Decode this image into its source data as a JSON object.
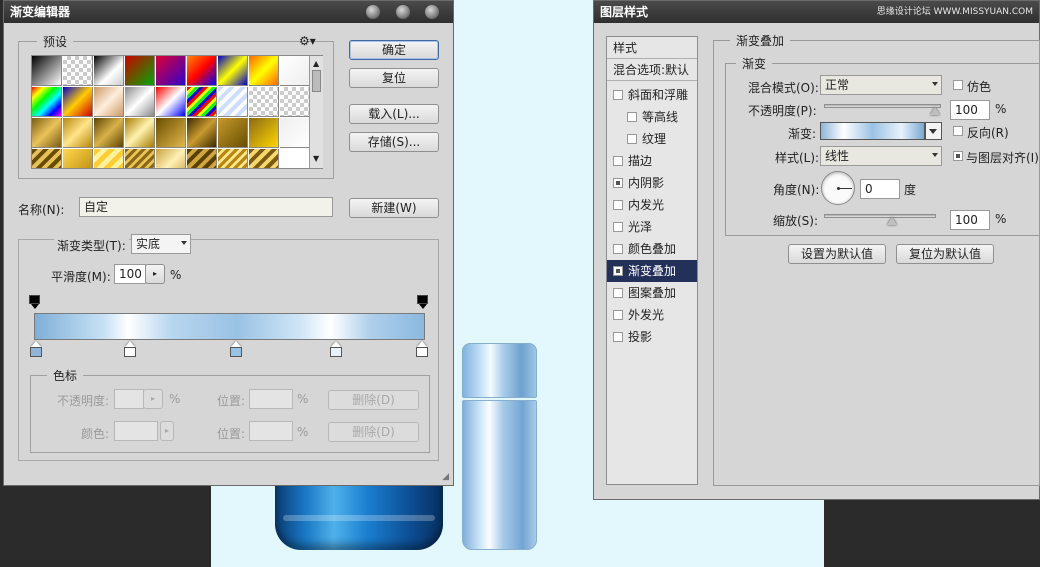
{
  "watermark": "思缘设计论坛 WWW.MISSYUAN.COM",
  "gradient_editor": {
    "title": "渐变编辑器",
    "presets_label": "预设",
    "buttons": {
      "ok": "确定",
      "reset": "复位",
      "load": "载入(L)...",
      "save": "存储(S)...",
      "new": "新建(W)"
    },
    "name_label": "名称(N):",
    "name_value": "自定",
    "gradient_type_label": "渐变类型(T):",
    "gradient_type_value": "实底",
    "smoothness_label": "平滑度(M):",
    "smoothness_value": "100",
    "percent": "%",
    "color_stops": {
      "title": "色标",
      "opacity_label": "不透明度:",
      "color_label": "颜色:",
      "position_label": "位置:",
      "delete_label": "删除(D)"
    }
  },
  "layer_style": {
    "title": "图层样式",
    "list_header": "样式",
    "blend_options": "混合选项:默认",
    "items": [
      {
        "label": "斜面和浮雕",
        "checked": false,
        "sub": false
      },
      {
        "label": "等高线",
        "checked": false,
        "sub": true
      },
      {
        "label": "纹理",
        "checked": false,
        "sub": true
      },
      {
        "label": "描边",
        "checked": false,
        "sub": false
      },
      {
        "label": "内阴影",
        "checked": true,
        "sub": false
      },
      {
        "label": "内发光",
        "checked": false,
        "sub": false
      },
      {
        "label": "光泽",
        "checked": false,
        "sub": false
      },
      {
        "label": "颜色叠加",
        "checked": false,
        "sub": false
      },
      {
        "label": "渐变叠加",
        "checked": true,
        "sub": false,
        "selected": true
      },
      {
        "label": "图案叠加",
        "checked": false,
        "sub": false
      },
      {
        "label": "外发光",
        "checked": false,
        "sub": false
      },
      {
        "label": "投影",
        "checked": false,
        "sub": false
      }
    ],
    "section_title": "渐变叠加",
    "sub_title": "渐变",
    "blend_mode_label": "混合模式(O):",
    "blend_mode_value": "正常",
    "dither_label": "仿色",
    "opacity_label": "不透明度(P):",
    "opacity_value": "100",
    "gradient_label": "渐变:",
    "reverse_label": "反向(R)",
    "style_label": "样式(L):",
    "style_value": "线性",
    "align_label": "与图层对齐(I)",
    "angle_label": "角度(N):",
    "angle_value": "0",
    "angle_unit": "度",
    "scale_label": "缩放(S):",
    "scale_value": "100",
    "percent": "%",
    "set_default": "设置为默认值",
    "reset_default": "复位为默认值"
  }
}
